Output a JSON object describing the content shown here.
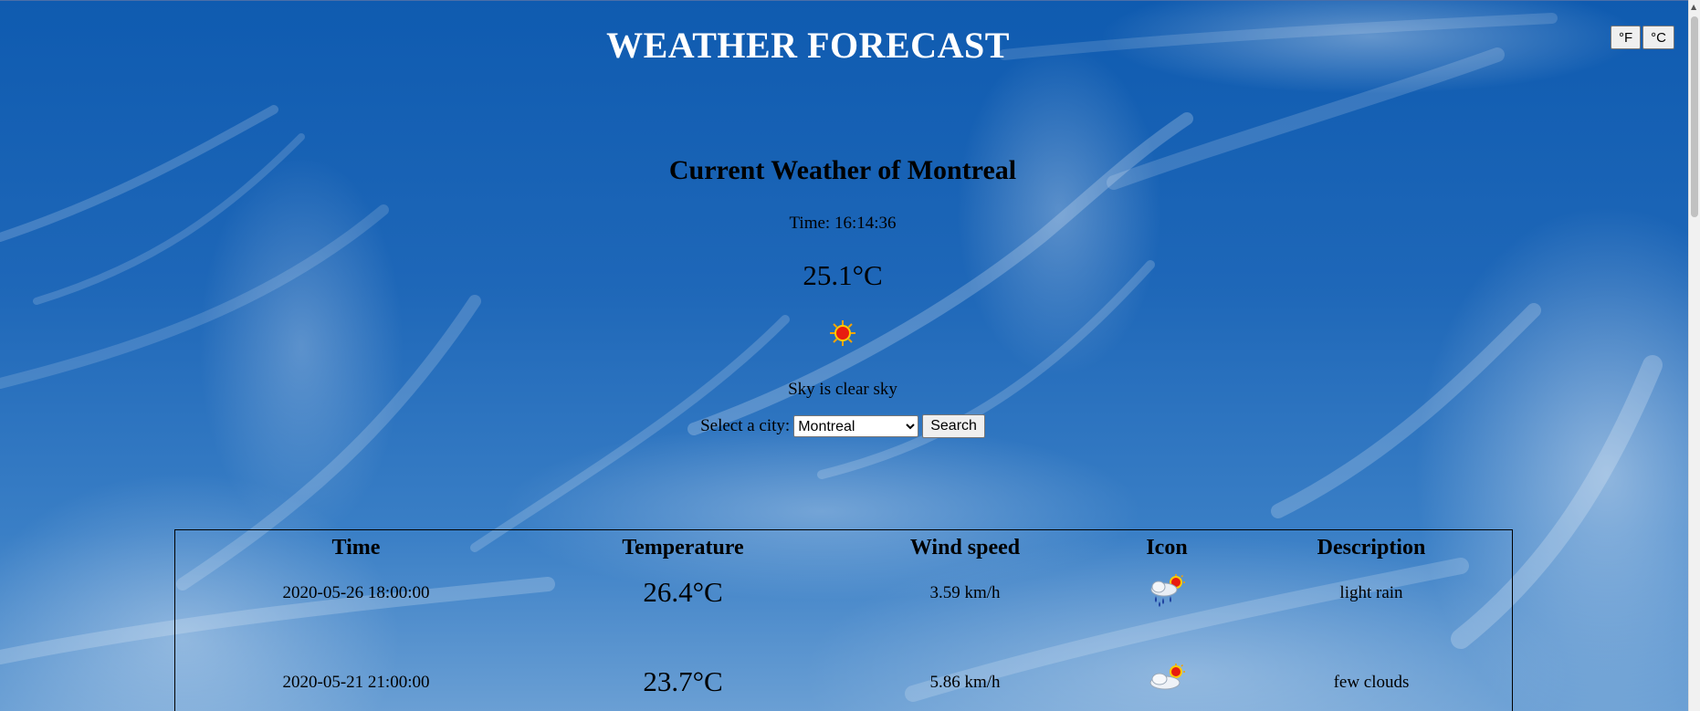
{
  "header": {
    "title": "WEATHER FORECAST",
    "unit_fahrenheit": "°F",
    "unit_celsius": "°C"
  },
  "current": {
    "heading": "Current Weather of Montreal",
    "time": "Time: 16:14:36",
    "temperature": "25.1°C",
    "icon": "clear-sun-icon",
    "description": "Sky is clear sky",
    "city_label": "Select a city:",
    "city_selected": "Montreal",
    "search_label": "Search"
  },
  "forecast": {
    "columns": [
      "Time",
      "Temperature",
      "Wind speed",
      "Icon",
      "Description"
    ],
    "rows": [
      {
        "time": "2020-05-26 18:00:00",
        "temperature": "26.4°C",
        "wind": "3.59 km/h",
        "icon": "rain-sun-icon",
        "description": "light rain"
      },
      {
        "time": "2020-05-21 21:00:00",
        "temperature": "23.7°C",
        "wind": "5.86 km/h",
        "icon": "cloud-sun-icon",
        "description": "few clouds"
      }
    ]
  },
  "colors": {
    "sky": "#1e67b8",
    "title_text": "#ffffff"
  }
}
